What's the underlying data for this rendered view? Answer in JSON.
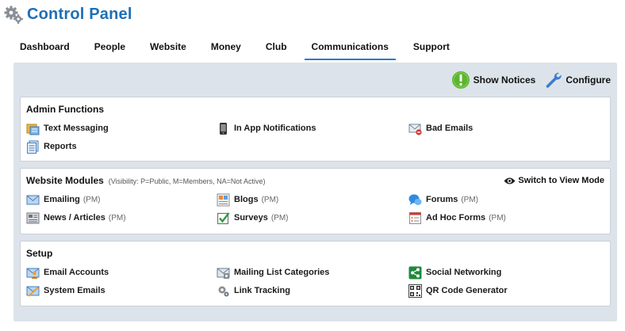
{
  "app": {
    "title": "Control Panel"
  },
  "tabs": [
    {
      "label": "Dashboard",
      "active": false
    },
    {
      "label": "People",
      "active": false
    },
    {
      "label": "Website",
      "active": false
    },
    {
      "label": "Money",
      "active": false
    },
    {
      "label": "Club",
      "active": false
    },
    {
      "label": "Communications",
      "active": true
    },
    {
      "label": "Support",
      "active": false
    }
  ],
  "toolbar": {
    "show_notices": "Show Notices",
    "configure": "Configure"
  },
  "admin": {
    "title": "Admin Functions",
    "items": {
      "text_messaging": "Text Messaging",
      "in_app_notifications": "In App Notifications",
      "bad_emails": "Bad Emails",
      "reports": "Reports"
    }
  },
  "modules": {
    "title": "Website Modules",
    "subtitle": "(Visibility: P=Public, M=Members, NA=Not Active)",
    "switch_label": "Switch to View Mode",
    "items": {
      "emailing": {
        "label": "Emailing",
        "vis": "(PM)"
      },
      "blogs": {
        "label": "Blogs",
        "vis": "(PM)"
      },
      "forums": {
        "label": "Forums",
        "vis": "(PM)"
      },
      "news": {
        "label": "News / Articles",
        "vis": "(PM)"
      },
      "surveys": {
        "label": "Surveys",
        "vis": "(PM)"
      },
      "adhoc": {
        "label": "Ad Hoc Forms",
        "vis": "(PM)"
      }
    }
  },
  "setup": {
    "title": "Setup",
    "items": {
      "email_accounts": "Email Accounts",
      "mailing_list": "Mailing List Categories",
      "social": "Social Networking",
      "system_emails": "System Emails",
      "link_tracking": "Link Tracking",
      "qr_code": "QR Code Generator"
    }
  },
  "colors": {
    "accent": "#1f6fb5",
    "tab_underline": "#2a7ad0",
    "panel_bg": "#dde3ea",
    "notice_green": "#5cb531",
    "social_green": "#1e8a3c"
  }
}
